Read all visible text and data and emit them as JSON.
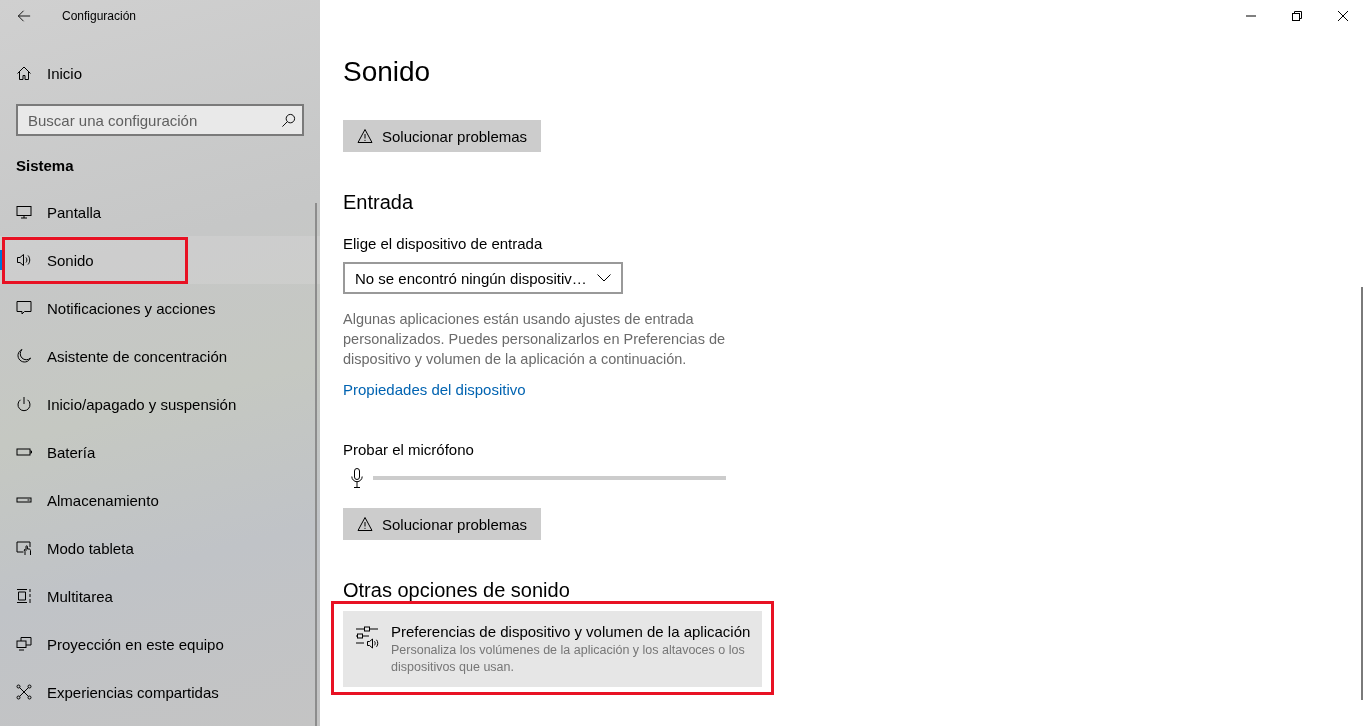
{
  "window": {
    "title": "Configuración"
  },
  "sidebar": {
    "home": {
      "label": "Inicio"
    },
    "search": {
      "placeholder": "Buscar una configuración"
    },
    "section_title": "Sistema",
    "items": [
      {
        "label": "Pantalla",
        "selected": false,
        "highlighted": false
      },
      {
        "label": "Sonido",
        "selected": true,
        "highlighted": true
      },
      {
        "label": "Notificaciones y acciones",
        "selected": false,
        "highlighted": false
      },
      {
        "label": "Asistente de concentración",
        "selected": false,
        "highlighted": false
      },
      {
        "label": "Inicio/apagado y suspensión",
        "selected": false,
        "highlighted": false
      },
      {
        "label": "Batería",
        "selected": false,
        "highlighted": false
      },
      {
        "label": "Almacenamiento",
        "selected": false,
        "highlighted": false
      },
      {
        "label": "Modo tableta",
        "selected": false,
        "highlighted": false
      },
      {
        "label": "Multitarea",
        "selected": false,
        "highlighted": false
      },
      {
        "label": "Proyección en este equipo",
        "selected": false,
        "highlighted": false
      },
      {
        "label": "Experiencias compartidas",
        "selected": false,
        "highlighted": false
      }
    ]
  },
  "content": {
    "title": "Sonido",
    "output_troubleshoot_button": "Solucionar problemas",
    "input_section": {
      "heading": "Entrada",
      "device_label": "Elige el dispositivo de entrada",
      "device_dropdown": {
        "value": "No se encontró ningún dispositiv…"
      },
      "note": "Algunas aplicaciones están usando ajustes de entrada personalizados. Puedes personalizarlos en Preferencias de dispositivo y volumen de la aplicación a continuación.",
      "properties_link": "Propiedades del dispositivo",
      "mic_test": {
        "label": "Probar el micrófono",
        "level": 0
      },
      "troubleshoot_button": "Solucionar problemas"
    },
    "other_section": {
      "heading": "Otras opciones de sonido",
      "options": [
        {
          "title": "Preferencias de dispositivo y volumen de la aplicación",
          "description": "Personaliza los volúmenes de la aplicación y los altavoces o los dispositivos que usan.",
          "highlighted": true
        }
      ]
    }
  }
}
